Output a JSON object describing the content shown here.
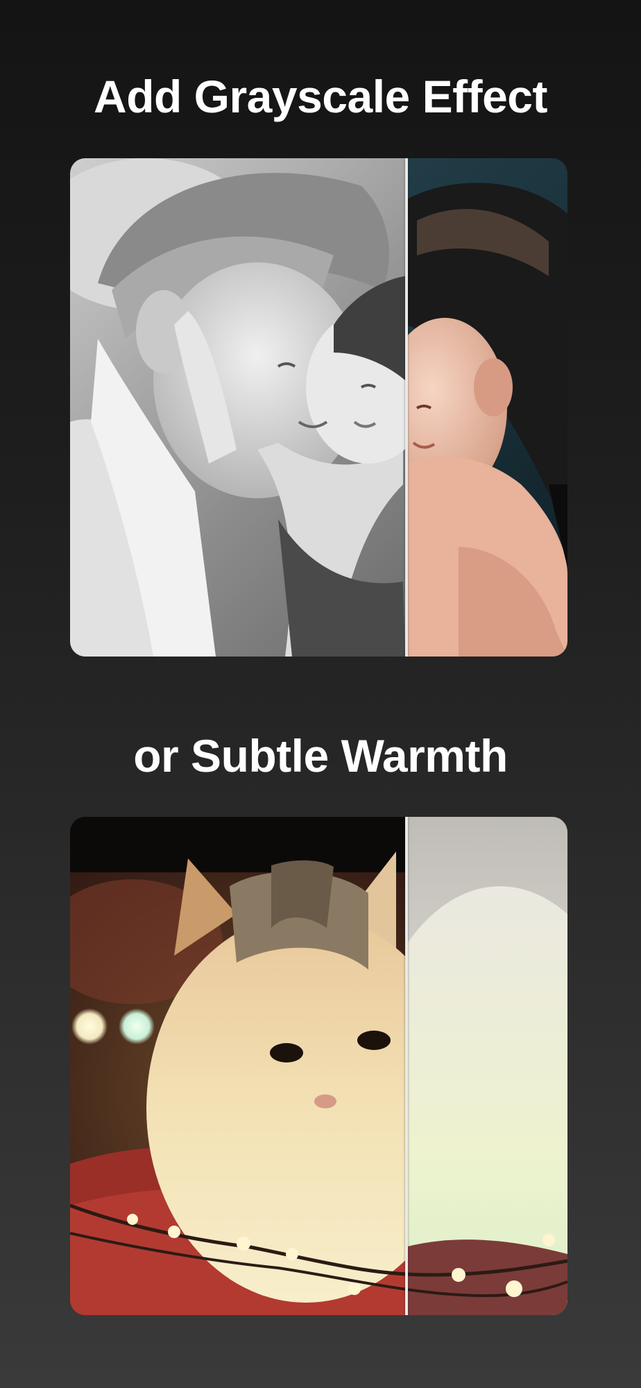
{
  "sections": [
    {
      "headline": "Add Grayscale Effect",
      "before_label": "grayscale",
      "after_label": "original"
    },
    {
      "headline": "or Subtle Warmth",
      "before_label": "warm",
      "after_label": "original"
    }
  ],
  "colors": {
    "background_top": "#141414",
    "background_bottom": "#3a3a3a",
    "headline_text": "#ffffff",
    "divider": "#e9e9e9"
  }
}
